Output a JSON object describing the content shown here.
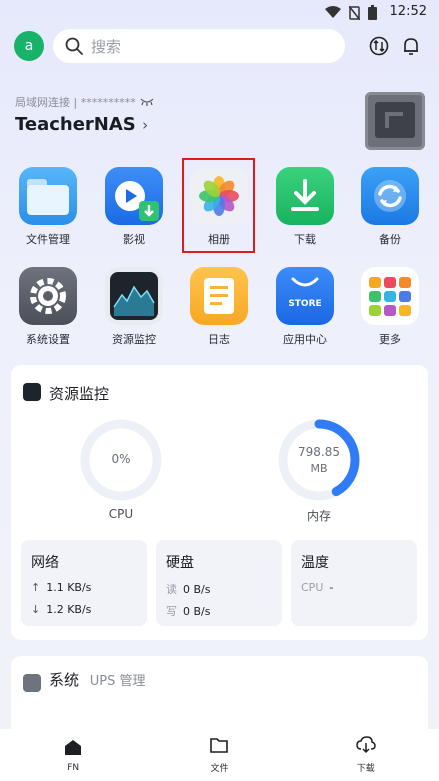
{
  "status": {
    "time": "12:52"
  },
  "header": {
    "avatar_letter": "a",
    "search_placeholder": "搜索"
  },
  "device": {
    "connection": "局域网连接 | **********",
    "name": "TeacherNAS"
  },
  "apps_row1": [
    {
      "label": "文件管理",
      "icon": "folder-icon"
    },
    {
      "label": "影视",
      "icon": "video-icon"
    },
    {
      "label": "相册",
      "icon": "photos-icon"
    },
    {
      "label": "下载",
      "icon": "download-icon"
    },
    {
      "label": "备份",
      "icon": "backup-icon"
    }
  ],
  "apps_row2": [
    {
      "label": "系统设置",
      "icon": "settings-icon"
    },
    {
      "label": "资源监控",
      "icon": "monitor-icon"
    },
    {
      "label": "日志",
      "icon": "log-icon"
    },
    {
      "label": "应用中心",
      "icon": "store-icon",
      "badge": "STORE"
    },
    {
      "label": "更多",
      "icon": "more-icon"
    }
  ],
  "monitor": {
    "title": "资源监控",
    "cpu": {
      "value": "0%",
      "label": "CPU",
      "fraction": 0.0
    },
    "memory": {
      "value": "798.85",
      "unit": "MB",
      "label": "内存",
      "fraction": 0.42
    },
    "network": {
      "title": "网络",
      "up": "1.1 KB/s",
      "down": "1.2 KB/s"
    },
    "disk": {
      "title": "硬盘",
      "read_label": "读",
      "read": "0 B/s",
      "write_label": "写",
      "write": "0 B/s"
    },
    "temp": {
      "title": "温度",
      "cpu_label": "CPU",
      "cpu_value": "-"
    }
  },
  "system": {
    "title": "系统",
    "subtitle": "UPS 管理"
  },
  "tabs": [
    {
      "label": "FN",
      "icon": "home-icon"
    },
    {
      "label": "文件",
      "icon": "folder-tab-icon"
    },
    {
      "label": "下载",
      "icon": "download-tab-icon"
    }
  ],
  "colors": {
    "accent": "#2f7cf6",
    "avatar": "#19b26b",
    "highlight": "#e11a1a"
  }
}
